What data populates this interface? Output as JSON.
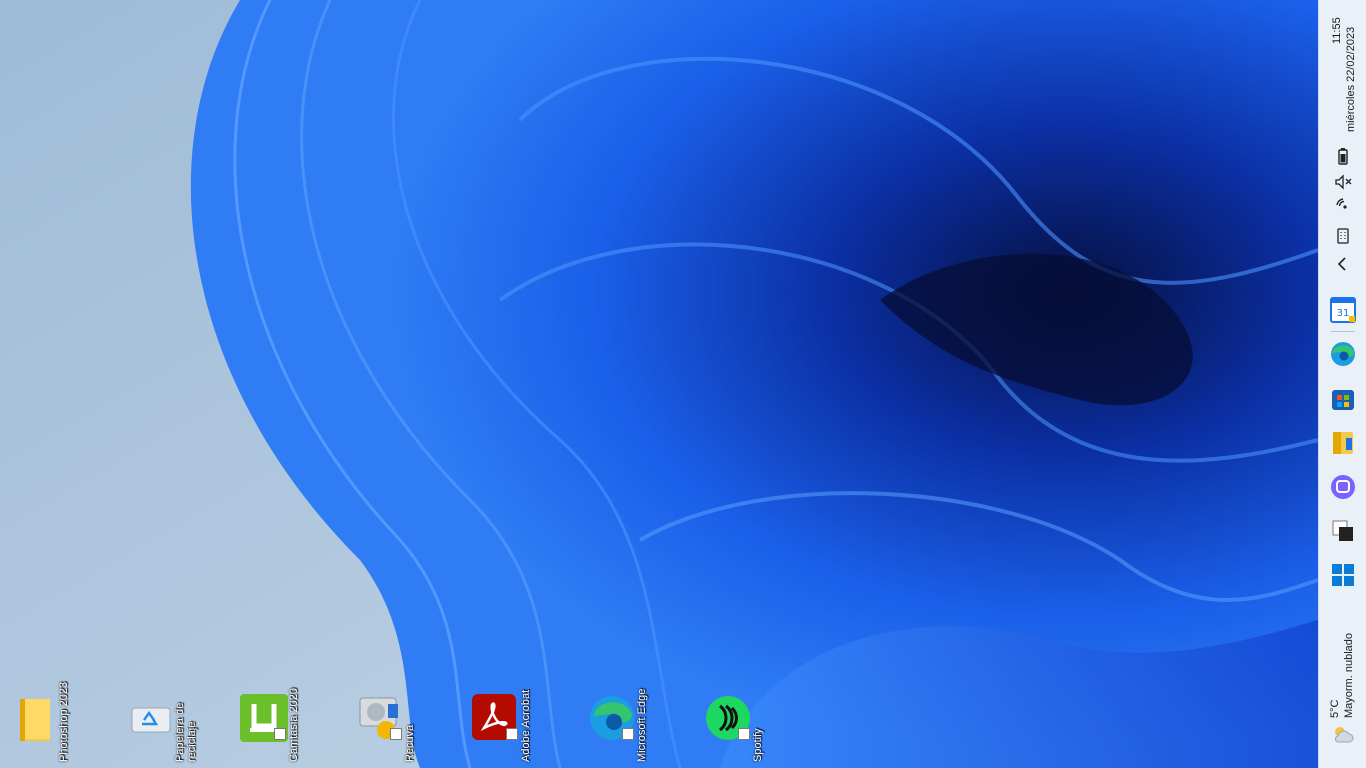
{
  "desktop": {
    "icons": [
      {
        "label": "Photoshop 2023",
        "icon": "folder-icon"
      },
      {
        "label": "Papelera de reciclaje",
        "icon": "recycle-bin-icon"
      },
      {
        "label": "Camtasia 2020",
        "icon": "camtasia-icon"
      },
      {
        "label": "Recuva",
        "icon": "recuva-icon"
      },
      {
        "label": "Adobe Acrobat",
        "icon": "acrobat-icon"
      },
      {
        "label": "Microsoft Edge",
        "icon": "edge-icon"
      },
      {
        "label": "Spotify",
        "icon": "spotify-icon"
      }
    ]
  },
  "taskbar": {
    "clock": {
      "time": "11:55",
      "date": "miércoles 22/02/2023"
    },
    "tray": [
      "battery-icon",
      "volume-muted-icon",
      "wifi-icon",
      "keyboard-icon",
      "chevron-left-icon"
    ],
    "apps": [
      "calendar-icon",
      "edge-icon",
      "store-icon",
      "file-explorer-icon",
      "teams-chat-icon",
      "task-view-icon",
      "start-icon"
    ],
    "weather": {
      "temp": "5°C",
      "condition": "Mayorm. nublado",
      "icon": "weather-cloudy-icon"
    }
  },
  "colors": {
    "wallpaper_base": "#a9c4dc",
    "bloom_blue": "#1a5fe8",
    "bloom_dark": "#0a1e6b",
    "taskbar_bg": "#eaf0f8"
  }
}
